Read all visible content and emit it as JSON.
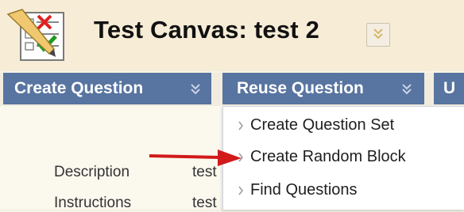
{
  "header": {
    "title": "Test Canvas: test 2"
  },
  "toolbar": {
    "buttons": [
      {
        "label": "Create Question"
      },
      {
        "label": "Reuse Question"
      },
      {
        "label": "U"
      }
    ]
  },
  "dropdown": {
    "items": [
      {
        "label": "Create Question Set"
      },
      {
        "label": "Create Random Block"
      },
      {
        "label": "Find Questions"
      }
    ]
  },
  "details": {
    "fields": [
      {
        "label": "Description",
        "value": "test"
      },
      {
        "label": "Instructions",
        "value": "test"
      }
    ]
  },
  "colors": {
    "toolbar_button": "#5874a0",
    "annotation_arrow": "#d11a1a",
    "header_bg": "#f7ecd6"
  },
  "icons": {
    "test": "test-checklist-icon",
    "title_menu": "chevron-down-icon",
    "button_chevron": "double-chevron-down-icon",
    "menu_bullet": "chevron-right-icon",
    "annotation": "red-arrow-icon"
  }
}
